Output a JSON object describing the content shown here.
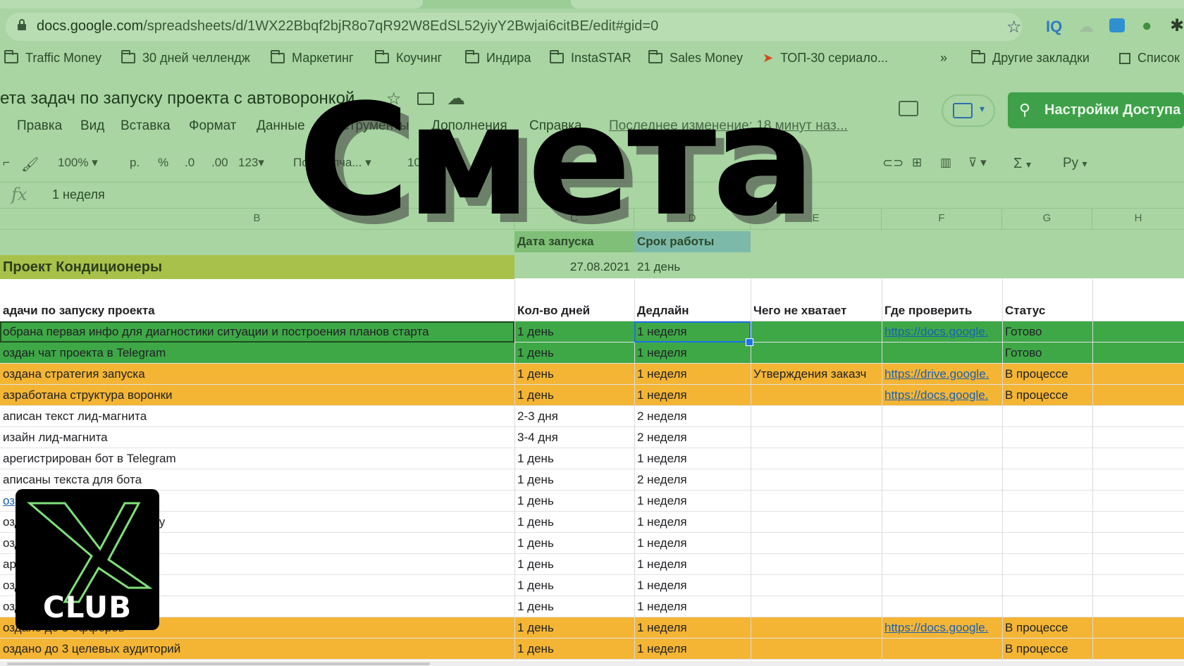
{
  "browser": {
    "url_host": "docs.google.com",
    "url_path": "/spreadsheets/d/1WX22Bbqf2bjR8o7qR92W8EdSL52yiyY2Bwjai6citBE/edit#gid=0",
    "ext_labels": [
      "IQ"
    ],
    "bookmarks": [
      "Traffic Money",
      "30 дней челлендж",
      "Маркетинг",
      "Коучинг",
      "Индира",
      "InstaSTAR",
      "Sales Money",
      "ТОП-30 сериало..."
    ],
    "bookmarks_more": "»",
    "other_bookmarks": "Другие закладки",
    "reading_list": "Список"
  },
  "doc": {
    "title": "ета задач по запуску проекта с автоворонкой",
    "menu": [
      "Правка",
      "Вид",
      "Вставка",
      "Формат",
      "Данные",
      "Инструменты",
      "Дополнения",
      "Справка"
    ],
    "last_edit": "Последнее изменение: 18 минут наз...",
    "share_label": "Настройки Доступа"
  },
  "toolbar": {
    "zoom": "100%",
    "currency": "р.",
    "percent": "%",
    "dec_less": ".0",
    "dec_more": ".00",
    "format_more": "123",
    "font": "По умолча...",
    "font_size": "10",
    "bold": "B",
    "func": "Σ",
    "input": "Ру"
  },
  "formula_bar": {
    "fx": "fx",
    "value": "1 неделя"
  },
  "columns": [
    "B",
    "C",
    "D",
    "E",
    "F",
    "G",
    "H"
  ],
  "header_block": {
    "launch_date_label": "Дата запуска",
    "duration_label": "Срок работы",
    "project": "Проект Кондиционеры",
    "launch_date": "27.08.2021",
    "duration": "21 день"
  },
  "table": {
    "headers": [
      "адачи по запуску проекта",
      "Кол-во дней",
      "Дедлайн",
      "Чего не хватает",
      "Где проверить",
      "Статус"
    ],
    "rows": [
      {
        "task": "обрана первая инфо для диагностики ситуации и построения планов старта",
        "days": "1 день",
        "deadline": "1 неделя",
        "missing": "",
        "check": "https://docs.google.",
        "status": "Готово",
        "color": "#3ea847"
      },
      {
        "task": "оздан чат проекта в Telegram",
        "days": "1 день",
        "deadline": "1 неделя",
        "missing": "",
        "check": "",
        "status": "Готово",
        "color": "#3ea847"
      },
      {
        "task": "оздана стратегия запуска",
        "days": "1 день",
        "deadline": "1 неделя",
        "missing": "Утверждения заказч",
        "check": "https://drive.google.",
        "status": "В процессе",
        "color": "#f4b534"
      },
      {
        "task": "азработана структура воронки",
        "days": "1 день",
        "deadline": "1 неделя",
        "missing": "",
        "check": "https://docs.google.",
        "status": "В процессе",
        "color": "#f4b534"
      },
      {
        "task": "аписан текст лид-магнита",
        "days": "2-3 дня",
        "deadline": "2 неделя",
        "missing": "",
        "check": "",
        "status": "",
        "color": "#ffffff"
      },
      {
        "task": "изайн лид-магнита",
        "days": "3-4 дня",
        "deadline": "2 неделя",
        "missing": "",
        "check": "",
        "status": "",
        "color": "#ffffff"
      },
      {
        "task": "арегистрирован бот в Telegram",
        "days": "1 день",
        "deadline": "1 неделя",
        "missing": "",
        "check": "",
        "status": "",
        "color": "#ffffff"
      },
      {
        "task": "аписаны текста для бота",
        "days": "1 день",
        "deadline": "2 неделя",
        "missing": "",
        "check": "",
        "status": "",
        "color": "#ffffff"
      },
      {
        "task": "оз",
        "days": "1 день",
        "deadline": "1 неделя",
        "missing": "",
        "check": "",
        "status": "",
        "color": "#ffffff"
      },
      {
        "task": "озд                    п к рекламному кабинету",
        "days": "1 день",
        "deadline": "1 неделя",
        "missing": "",
        "check": "",
        "status": "",
        "color": "#ffffff"
      },
      {
        "task": "озд                    + привязка к Instagram",
        "days": "1 день",
        "deadline": "1 неделя",
        "missing": "",
        "check": "",
        "status": "",
        "color": "#ffffff"
      },
      {
        "task": "ар                     в BotHelp/Smarsender",
        "days": "1 день",
        "deadline": "1 неделя",
        "missing": "",
        "check": "",
        "status": "",
        "color": "#ffffff"
      },
      {
        "task": "озд",
        "days": "1 день",
        "deadline": "1 неделя",
        "missing": "",
        "check": "",
        "status": "",
        "color": "#ffffff"
      },
      {
        "task": "озд                    екламы",
        "days": "1 день",
        "deadline": "1 неделя",
        "missing": "",
        "check": "",
        "status": "",
        "color": "#ffffff"
      },
      {
        "task": "оздано до 3 офферов",
        "days": "1 день",
        "deadline": "1 неделя",
        "missing": "",
        "check": "https://docs.google.",
        "status": "В процессе",
        "color": "#f4b534"
      },
      {
        "task": "оздано до 3 целевых аудиторий",
        "days": "1 день",
        "deadline": "1 неделя",
        "missing": "",
        "check": "",
        "status": "В процессе",
        "color": "#f4b534"
      }
    ]
  },
  "overlay": {
    "headline": "Смета",
    "logo_letter": "X",
    "logo_word": "CLUB"
  }
}
